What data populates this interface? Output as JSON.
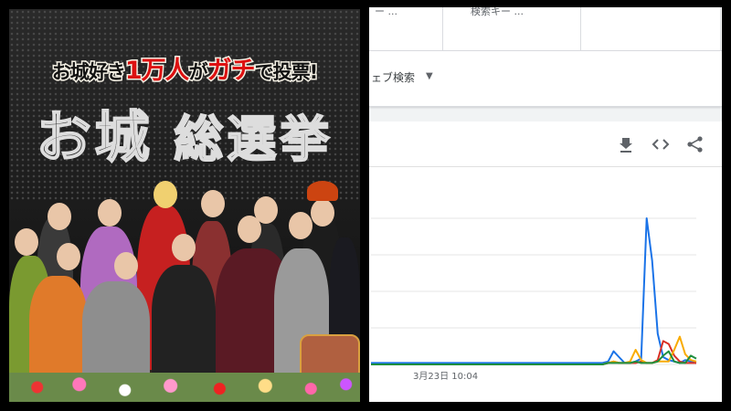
{
  "photo": {
    "tagline_part1": "お城好き",
    "tagline_part2": "1万人",
    "tagline_part3": "が",
    "tagline_part4": "ガチ",
    "tagline_part5": "で投票!",
    "title_part1": "お城",
    "title_part2": "総選挙"
  },
  "trends": {
    "tabs": [
      {
        "label": "ー ..."
      },
      {
        "label": "検索キー ..."
      },
      {
        "label": ""
      }
    ],
    "filter_label": "ェブ検索",
    "tools": [
      "download-icon",
      "embed-icon",
      "share-icon"
    ],
    "colors": {
      "blue": "#1a73e8",
      "red": "#d93025",
      "yellow": "#f9ab00",
      "green": "#1e8e3e"
    }
  },
  "chart_data": {
    "type": "line",
    "x_tick_labels": [
      "3月23日 10:04"
    ],
    "ylim": [
      0,
      100
    ],
    "grid": true,
    "series": [
      {
        "color": "#1a73e8",
        "values": [
          1,
          1,
          1,
          1,
          1,
          1,
          1,
          1,
          1,
          1,
          1,
          1,
          1,
          1,
          1,
          1,
          1,
          1,
          1,
          1,
          1,
          1,
          1,
          1,
          1,
          1,
          1,
          1,
          1,
          1,
          1,
          1,
          1,
          1,
          1,
          1,
          1,
          1,
          1,
          1,
          1,
          1,
          1,
          2,
          9,
          5,
          1,
          1,
          2,
          4,
          100,
          71,
          21,
          5,
          3,
          2,
          1,
          3,
          2,
          1
        ]
      },
      {
        "color": "#d93025",
        "values": [
          0,
          0,
          0,
          0,
          0,
          0,
          0,
          0,
          0,
          0,
          0,
          0,
          0,
          0,
          0,
          0,
          0,
          0,
          0,
          0,
          0,
          0,
          0,
          0,
          0,
          0,
          0,
          0,
          0,
          0,
          0,
          0,
          0,
          0,
          0,
          0,
          0,
          0,
          0,
          0,
          0,
          0,
          0,
          1,
          2,
          1,
          1,
          1,
          1,
          2,
          1,
          1,
          3,
          16,
          14,
          6,
          2,
          1,
          1,
          1
        ]
      },
      {
        "color": "#f9ab00",
        "values": [
          0,
          0,
          0,
          0,
          0,
          0,
          0,
          0,
          0,
          0,
          0,
          0,
          0,
          0,
          0,
          0,
          0,
          0,
          0,
          0,
          0,
          0,
          0,
          0,
          0,
          0,
          0,
          0,
          0,
          0,
          0,
          0,
          0,
          0,
          0,
          0,
          0,
          0,
          0,
          0,
          0,
          0,
          0,
          1,
          2,
          1,
          1,
          2,
          10,
          3,
          1,
          1,
          2,
          2,
          2,
          10,
          19,
          7,
          3,
          2
        ]
      },
      {
        "color": "#1e8e3e",
        "values": [
          0,
          0,
          0,
          0,
          0,
          0,
          0,
          0,
          0,
          0,
          0,
          0,
          0,
          0,
          0,
          0,
          0,
          0,
          0,
          0,
          0,
          0,
          0,
          0,
          0,
          0,
          0,
          0,
          0,
          0,
          0,
          0,
          0,
          0,
          0,
          0,
          0,
          0,
          0,
          0,
          0,
          0,
          0,
          1,
          1,
          1,
          1,
          1,
          2,
          1,
          1,
          1,
          2,
          6,
          9,
          2,
          1,
          1,
          6,
          4
        ]
      }
    ]
  }
}
